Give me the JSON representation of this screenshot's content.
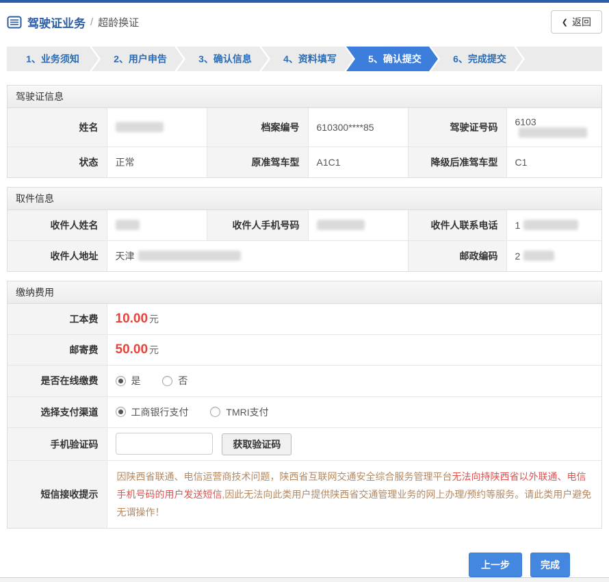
{
  "header": {
    "title": "驾驶证业务",
    "separator": "/",
    "subtitle": "超龄换证",
    "back_chevron": "❮",
    "back_label": "返回"
  },
  "steps": [
    {
      "label": "1、业务须知",
      "active": false
    },
    {
      "label": "2、用户申告",
      "active": false
    },
    {
      "label": "3、确认信息",
      "active": false
    },
    {
      "label": "4、资料填写",
      "active": false
    },
    {
      "label": "5、确认提交",
      "active": true
    },
    {
      "label": "6、完成提交",
      "active": false
    }
  ],
  "sections": {
    "license": {
      "title": "驾驶证信息",
      "rows": [
        {
          "cells": [
            {
              "label": "姓名",
              "value": "",
              "redacted": true
            },
            {
              "label": "档案编号",
              "value": "610300****85",
              "redacted": false
            },
            {
              "label": "驾驶证号码",
              "value": "6103",
              "redacted": true
            }
          ]
        },
        {
          "cells": [
            {
              "label": "状态",
              "value": "正常",
              "redacted": false
            },
            {
              "label": "原准驾车型",
              "value": "A1C1",
              "redacted": false
            },
            {
              "label": "降级后准驾车型",
              "value": "C1",
              "redacted": false
            }
          ]
        }
      ]
    },
    "pickup": {
      "title": "取件信息",
      "row1": [
        {
          "label": "收件人姓名",
          "value": "",
          "redacted": true
        },
        {
          "label": "收件人手机号码",
          "value": "",
          "redacted": true
        },
        {
          "label": "收件人联系电话",
          "value": "1",
          "redacted": true
        }
      ],
      "row2": [
        {
          "label": "收件人地址",
          "value": "天津",
          "redacted": true
        },
        {
          "label": "邮政编码",
          "value": "2",
          "redacted": true
        }
      ]
    },
    "payment": {
      "title": "缴纳费用",
      "fees": [
        {
          "label": "工本费",
          "amount": "10.00",
          "unit": "元"
        },
        {
          "label": "邮寄费",
          "amount": "50.00",
          "unit": "元"
        }
      ],
      "online_pay": {
        "label": "是否在线缴费",
        "options": [
          {
            "label": "是",
            "selected": true
          },
          {
            "label": "否",
            "selected": false
          }
        ]
      },
      "pay_channel": {
        "label": "选择支付渠道",
        "options": [
          {
            "label": "工商银行支付",
            "selected": true
          },
          {
            "label": "TMRI支付",
            "selected": false
          }
        ]
      },
      "sms_code": {
        "label": "手机验证码",
        "input_value": "",
        "button_label": "获取验证码"
      },
      "sms_notice": {
        "label": "短信接收提示",
        "text_normal_1": "因陕西省联通、电信运营商技术问题，陕西省互联网交通安全综合服务管理平台",
        "text_emphasis": "无法向持陕西省以外联通、电信手机号码的用户发送短信",
        "text_normal_2": ",因此无法向此类用户提供陕西省交通管理业务的网上办理/预约等服务。请此类用户避免无谓操作！"
      }
    }
  },
  "footer": {
    "prev_label": "上一步",
    "finish_label": "完成"
  },
  "colors": {
    "primary_blue": "#2b5da8",
    "active_step_blue": "#3d7edd",
    "button_blue": "#4487e1",
    "fee_red": "#e6433d",
    "notice_normal": "#b6885f",
    "notice_emphasis": "#e0524e"
  }
}
